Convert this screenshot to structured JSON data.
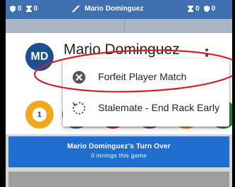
{
  "status_bar": {
    "left_count_a": "0",
    "left_count_b": "0",
    "player_name": "Mario Dominguez",
    "right_count_a": "0",
    "right_count_b": "0"
  },
  "player": {
    "initials": "MD",
    "name": "Mario Dominguez"
  },
  "menu": {
    "items": [
      {
        "label": "Forfeit Player Match",
        "icon": "close-circle-icon"
      },
      {
        "label": "Stalemate - End Rack Early",
        "icon": "dotted-refresh-icon"
      }
    ]
  },
  "balls": {
    "first_number": "1",
    "colors": [
      "#f0a81c",
      "#2c5aa8",
      "#cc2a2a",
      "#7c3fa0",
      "#e07a2a",
      "#2a8a3e"
    ]
  },
  "turn": {
    "title": "Mario Dominguez's Turn Over",
    "subtitle": "0 innings this game"
  },
  "colors": {
    "top_bar": "#3f6fb0",
    "banner": "#1f6fd0",
    "annotation": "#d21f2a"
  }
}
